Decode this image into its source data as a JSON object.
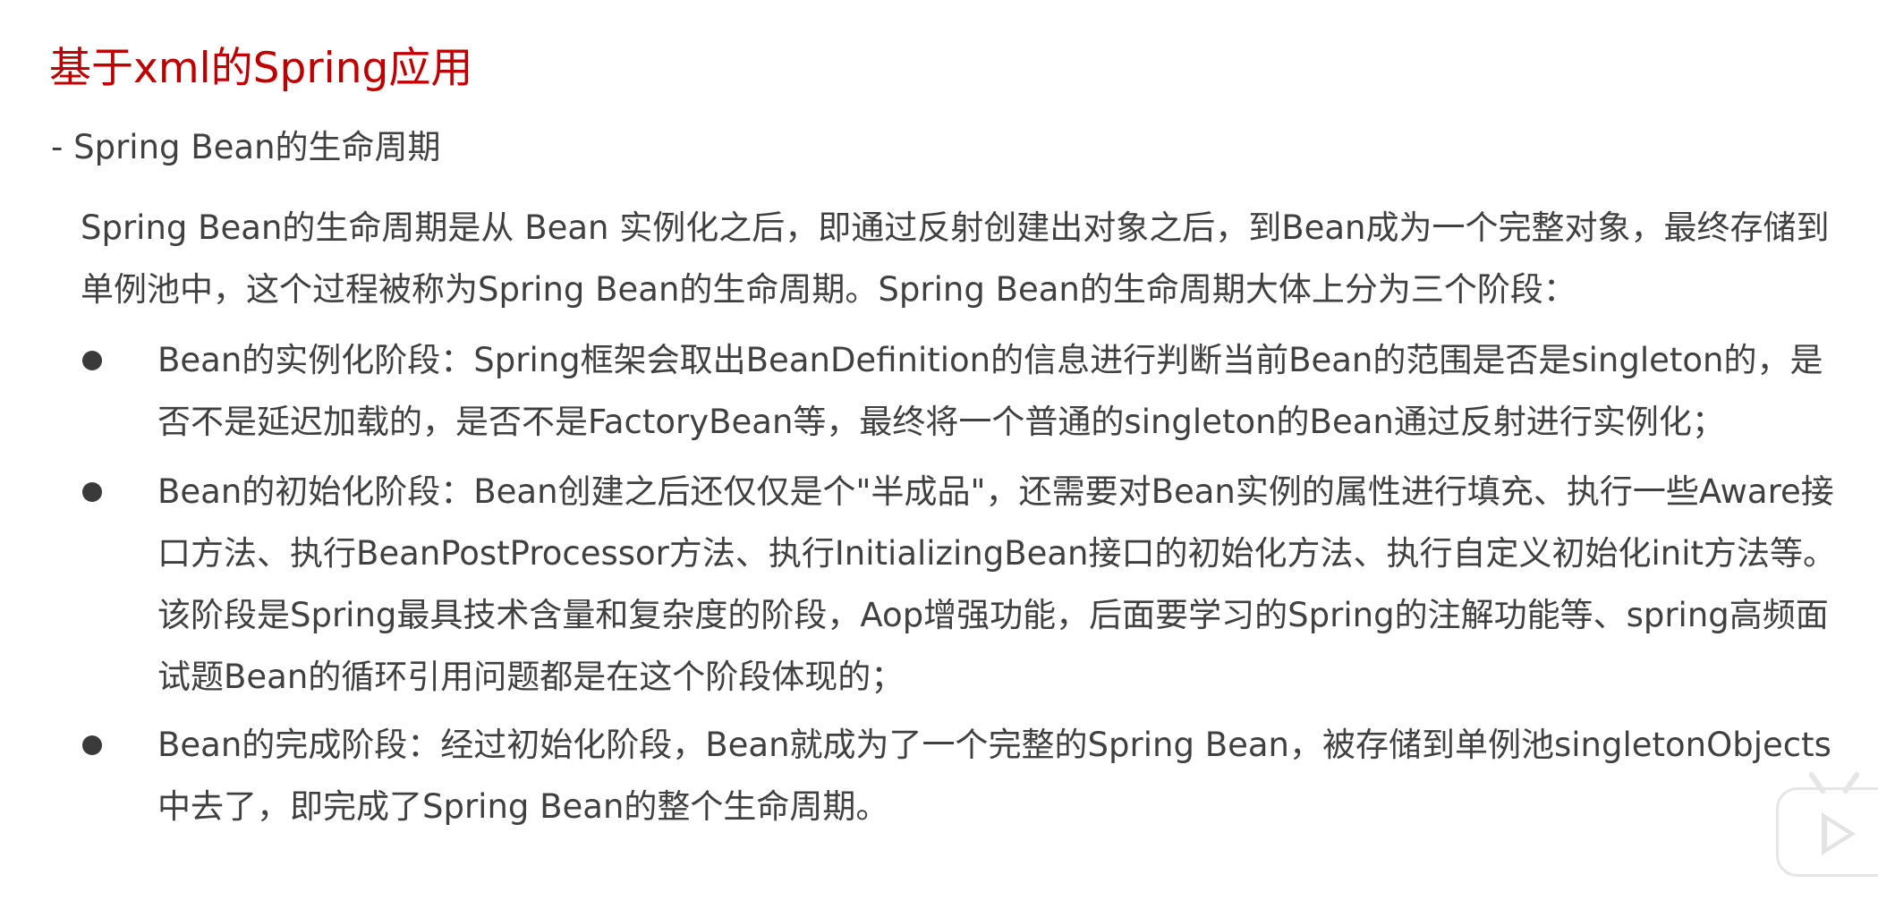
{
  "title": "基于xml的Spring应用",
  "subtitle": "- Spring Bean的生命周期",
  "intro": "Spring Bean的生命周期是从 Bean 实例化之后，即通过反射创建出对象之后，到Bean成为一个完整对象，最终存储到单例池中，这个过程被称为Spring Bean的生命周期。Spring Bean的生命周期大体上分为三个阶段：",
  "bullets": [
    {
      "text": "Bean的实例化阶段：Spring框架会取出BeanDefinition的信息进行判断当前Bean的范围是否是singleton的，是否不是延迟加载的，是否不是FactoryBean等，最终将一个普通的singleton的Bean通过反射进行实例化；"
    },
    {
      "text": "Bean的初始化阶段：Bean创建之后还仅仅是个\"半成品\"，还需要对Bean实例的属性进行填充、执行一些Aware接口方法、执行BeanPostProcessor方法、执行InitializingBean接口的初始化方法、执行自定义初始化init方法等。该阶段是Spring最具技术含量和复杂度的阶段，Aop增强功能，后面要学习的Spring的注解功能等、spring高频面试题Bean的循环引用问题都是在这个阶段体现的；"
    },
    {
      "text": "Bean的完成阶段：经过初始化阶段，Bean就成为了一个完整的Spring Bean，被存储到单例池singletonObjects中去了，即完成了Spring Bean的整个生命周期。"
    }
  ],
  "player_icon": "video-play-icon"
}
